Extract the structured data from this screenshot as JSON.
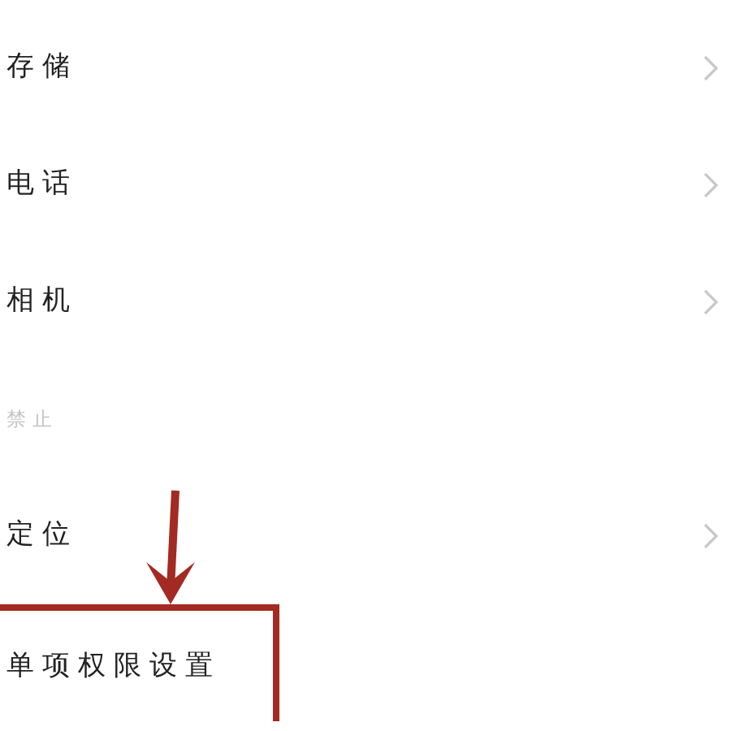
{
  "items": [
    {
      "kind": "row",
      "label": "存储",
      "chevron": true,
      "highlighted": false
    },
    {
      "kind": "row",
      "label": "电话",
      "chevron": true,
      "highlighted": false
    },
    {
      "kind": "row",
      "label": "相机",
      "chevron": true,
      "highlighted": false
    },
    {
      "kind": "header",
      "label": "禁止"
    },
    {
      "kind": "row",
      "label": "定位",
      "chevron": true,
      "highlighted": false
    },
    {
      "kind": "row",
      "label": "单项权限设置",
      "chevron": false,
      "highlighted": true
    }
  ]
}
